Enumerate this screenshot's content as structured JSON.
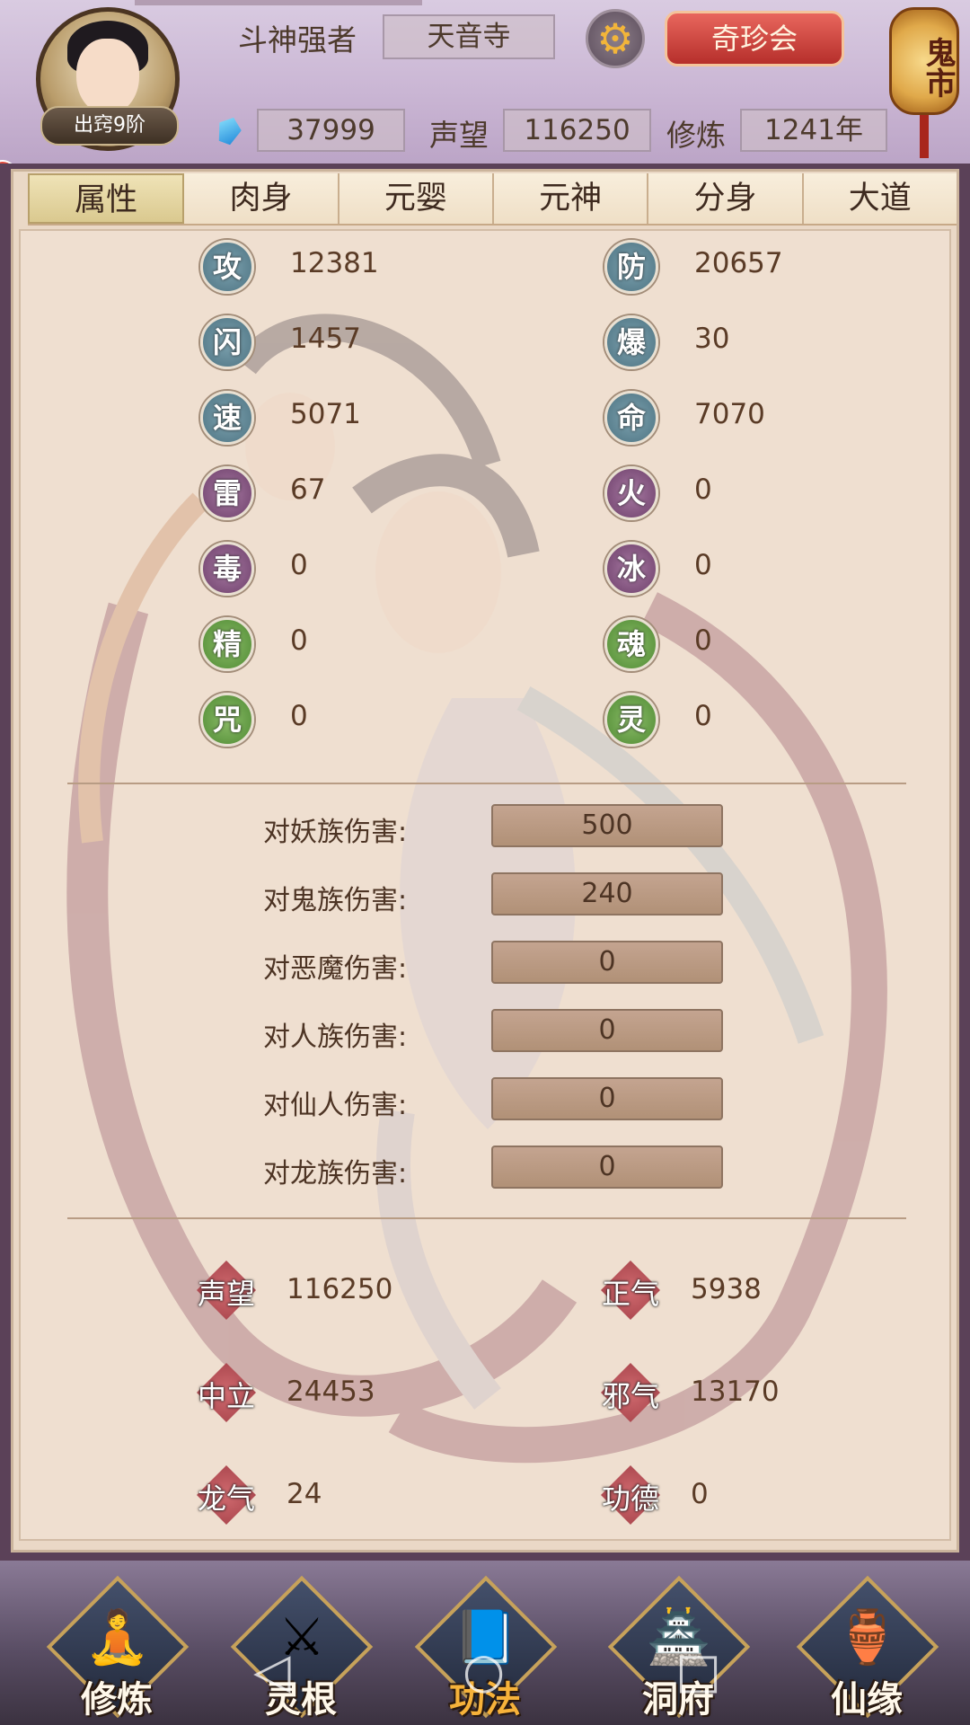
{
  "header": {
    "avatar_rank": "出窍9阶",
    "title": "斗神强者",
    "sect": "天音寺",
    "treasure_button": "奇珍会",
    "ghost_market": "鬼市",
    "gems": "37999",
    "reputation_label": "声望",
    "reputation": "116250",
    "cultivation_label": "修炼",
    "cultivation": "1241年"
  },
  "tabs": [
    "属性",
    "肉身",
    "元婴",
    "元神",
    "分身",
    "大道"
  ],
  "active_tab": "属性",
  "attributes": {
    "left": [
      {
        "glyph": "攻",
        "value": "12381",
        "color": "blue"
      },
      {
        "glyph": "闪",
        "value": "1457",
        "color": "blue"
      },
      {
        "glyph": "速",
        "value": "5071",
        "color": "blue"
      },
      {
        "glyph": "雷",
        "value": "67",
        "color": "purple"
      },
      {
        "glyph": "毒",
        "value": "0",
        "color": "purple"
      },
      {
        "glyph": "精",
        "value": "0",
        "color": "green"
      },
      {
        "glyph": "咒",
        "value": "0",
        "color": "green"
      }
    ],
    "right": [
      {
        "glyph": "防",
        "value": "20657",
        "color": "blue"
      },
      {
        "glyph": "爆",
        "value": "30",
        "color": "blue"
      },
      {
        "glyph": "命",
        "value": "7070",
        "color": "blue"
      },
      {
        "glyph": "火",
        "value": "0",
        "color": "purple"
      },
      {
        "glyph": "冰",
        "value": "0",
        "color": "purple"
      },
      {
        "glyph": "魂",
        "value": "0",
        "color": "green"
      },
      {
        "glyph": "灵",
        "value": "0",
        "color": "green"
      }
    ]
  },
  "damage": [
    {
      "label": "对妖族伤害:",
      "value": "500"
    },
    {
      "label": "对鬼族伤害:",
      "value": "240"
    },
    {
      "label": "对恶魔伤害:",
      "value": "0"
    },
    {
      "label": "对人族伤害:",
      "value": "0"
    },
    {
      "label": "对仙人伤害:",
      "value": "0"
    },
    {
      "label": "对龙族伤害:",
      "value": "0"
    }
  ],
  "reputation_stats": {
    "left": [
      {
        "label": "声望",
        "value": "116250"
      },
      {
        "label": "中立",
        "value": "24453"
      },
      {
        "label": "龙气",
        "value": "24"
      }
    ],
    "right": [
      {
        "label": "正气",
        "value": "5938"
      },
      {
        "label": "邪气",
        "value": "13170"
      },
      {
        "label": "功德",
        "value": "0"
      }
    ]
  },
  "bottom_nav": [
    {
      "label": "修炼",
      "icon": "monk-icon"
    },
    {
      "label": "灵根",
      "icon": "sword-icon"
    },
    {
      "label": "功法",
      "icon": "book-icon"
    },
    {
      "label": "洞府",
      "icon": "palace-icon"
    },
    {
      "label": "仙缘",
      "icon": "gourd-icon"
    }
  ],
  "active_nav": "功法",
  "colors": {
    "panel_bg": "#efdfd0",
    "frame": "#5b4158",
    "text": "#5a3b26",
    "badge_blue": "#4d7382",
    "badge_purple": "#6d3f6a",
    "badge_green": "#4f8a33",
    "badge_red": "#9f3c44",
    "treasure_red": "#c13a33",
    "active_nav": "#f6b23a"
  }
}
